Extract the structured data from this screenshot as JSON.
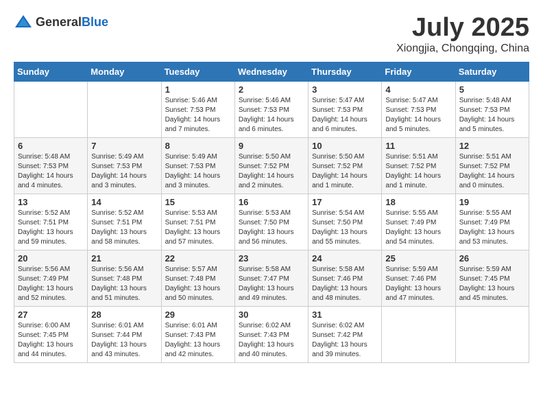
{
  "logo": {
    "general": "General",
    "blue": "Blue"
  },
  "header": {
    "month": "July 2025",
    "location": "Xiongjia, Chongqing, China"
  },
  "weekdays": [
    "Sunday",
    "Monday",
    "Tuesday",
    "Wednesday",
    "Thursday",
    "Friday",
    "Saturday"
  ],
  "weeks": [
    [
      {
        "day": "",
        "info": ""
      },
      {
        "day": "",
        "info": ""
      },
      {
        "day": "1",
        "info": "Sunrise: 5:46 AM\nSunset: 7:53 PM\nDaylight: 14 hours\nand 7 minutes."
      },
      {
        "day": "2",
        "info": "Sunrise: 5:46 AM\nSunset: 7:53 PM\nDaylight: 14 hours\nand 6 minutes."
      },
      {
        "day": "3",
        "info": "Sunrise: 5:47 AM\nSunset: 7:53 PM\nDaylight: 14 hours\nand 6 minutes."
      },
      {
        "day": "4",
        "info": "Sunrise: 5:47 AM\nSunset: 7:53 PM\nDaylight: 14 hours\nand 5 minutes."
      },
      {
        "day": "5",
        "info": "Sunrise: 5:48 AM\nSunset: 7:53 PM\nDaylight: 14 hours\nand 5 minutes."
      }
    ],
    [
      {
        "day": "6",
        "info": "Sunrise: 5:48 AM\nSunset: 7:53 PM\nDaylight: 14 hours\nand 4 minutes."
      },
      {
        "day": "7",
        "info": "Sunrise: 5:49 AM\nSunset: 7:53 PM\nDaylight: 14 hours\nand 3 minutes."
      },
      {
        "day": "8",
        "info": "Sunrise: 5:49 AM\nSunset: 7:53 PM\nDaylight: 14 hours\nand 3 minutes."
      },
      {
        "day": "9",
        "info": "Sunrise: 5:50 AM\nSunset: 7:52 PM\nDaylight: 14 hours\nand 2 minutes."
      },
      {
        "day": "10",
        "info": "Sunrise: 5:50 AM\nSunset: 7:52 PM\nDaylight: 14 hours\nand 1 minute."
      },
      {
        "day": "11",
        "info": "Sunrise: 5:51 AM\nSunset: 7:52 PM\nDaylight: 14 hours\nand 1 minute."
      },
      {
        "day": "12",
        "info": "Sunrise: 5:51 AM\nSunset: 7:52 PM\nDaylight: 14 hours\nand 0 minutes."
      }
    ],
    [
      {
        "day": "13",
        "info": "Sunrise: 5:52 AM\nSunset: 7:51 PM\nDaylight: 13 hours\nand 59 minutes."
      },
      {
        "day": "14",
        "info": "Sunrise: 5:52 AM\nSunset: 7:51 PM\nDaylight: 13 hours\nand 58 minutes."
      },
      {
        "day": "15",
        "info": "Sunrise: 5:53 AM\nSunset: 7:51 PM\nDaylight: 13 hours\nand 57 minutes."
      },
      {
        "day": "16",
        "info": "Sunrise: 5:53 AM\nSunset: 7:50 PM\nDaylight: 13 hours\nand 56 minutes."
      },
      {
        "day": "17",
        "info": "Sunrise: 5:54 AM\nSunset: 7:50 PM\nDaylight: 13 hours\nand 55 minutes."
      },
      {
        "day": "18",
        "info": "Sunrise: 5:55 AM\nSunset: 7:49 PM\nDaylight: 13 hours\nand 54 minutes."
      },
      {
        "day": "19",
        "info": "Sunrise: 5:55 AM\nSunset: 7:49 PM\nDaylight: 13 hours\nand 53 minutes."
      }
    ],
    [
      {
        "day": "20",
        "info": "Sunrise: 5:56 AM\nSunset: 7:49 PM\nDaylight: 13 hours\nand 52 minutes."
      },
      {
        "day": "21",
        "info": "Sunrise: 5:56 AM\nSunset: 7:48 PM\nDaylight: 13 hours\nand 51 minutes."
      },
      {
        "day": "22",
        "info": "Sunrise: 5:57 AM\nSunset: 7:48 PM\nDaylight: 13 hours\nand 50 minutes."
      },
      {
        "day": "23",
        "info": "Sunrise: 5:58 AM\nSunset: 7:47 PM\nDaylight: 13 hours\nand 49 minutes."
      },
      {
        "day": "24",
        "info": "Sunrise: 5:58 AM\nSunset: 7:46 PM\nDaylight: 13 hours\nand 48 minutes."
      },
      {
        "day": "25",
        "info": "Sunrise: 5:59 AM\nSunset: 7:46 PM\nDaylight: 13 hours\nand 47 minutes."
      },
      {
        "day": "26",
        "info": "Sunrise: 5:59 AM\nSunset: 7:45 PM\nDaylight: 13 hours\nand 45 minutes."
      }
    ],
    [
      {
        "day": "27",
        "info": "Sunrise: 6:00 AM\nSunset: 7:45 PM\nDaylight: 13 hours\nand 44 minutes."
      },
      {
        "day": "28",
        "info": "Sunrise: 6:01 AM\nSunset: 7:44 PM\nDaylight: 13 hours\nand 43 minutes."
      },
      {
        "day": "29",
        "info": "Sunrise: 6:01 AM\nSunset: 7:43 PM\nDaylight: 13 hours\nand 42 minutes."
      },
      {
        "day": "30",
        "info": "Sunrise: 6:02 AM\nSunset: 7:43 PM\nDaylight: 13 hours\nand 40 minutes."
      },
      {
        "day": "31",
        "info": "Sunrise: 6:02 AM\nSunset: 7:42 PM\nDaylight: 13 hours\nand 39 minutes."
      },
      {
        "day": "",
        "info": ""
      },
      {
        "day": "",
        "info": ""
      }
    ]
  ]
}
